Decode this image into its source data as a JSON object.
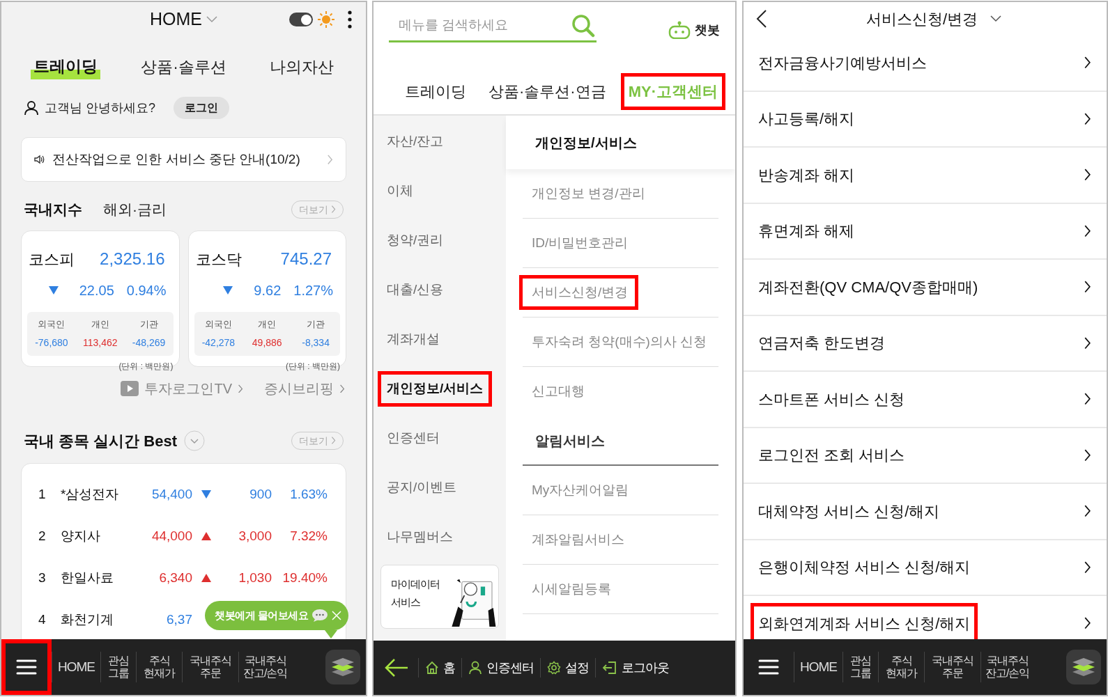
{
  "home_screen": {
    "header": {
      "title": "HOME",
      "dark_mode_toggle": {
        "on": true
      }
    },
    "tabs": [
      {
        "label": "트레이딩",
        "selected": true
      },
      {
        "label": "상품·솔루션",
        "selected": false
      },
      {
        "label": "나의자산",
        "selected": false
      }
    ],
    "greeting": "고객님 안녕하세요?",
    "login_button": "로그인",
    "notice": "전산작업으로 인한 서비스 중단 안내(10/2)",
    "index_tabs": [
      {
        "label": "국내지수",
        "selected": true
      },
      {
        "label": "해외·금리",
        "selected": false
      }
    ],
    "more_button": "더보기",
    "index_cards": [
      {
        "name": "코스피",
        "value": "2,325.16",
        "rising": false,
        "change": "22.05",
        "rate": "0.94%",
        "investors": [
          {
            "label": "외국인",
            "value": "-76,680",
            "rising": false
          },
          {
            "label": "개인",
            "value": "113,462",
            "rising": true
          },
          {
            "label": "기관",
            "value": "-48,269",
            "rising": false
          }
        ],
        "unit": "(단위 : 백만원)"
      },
      {
        "name": "코스닥",
        "value": "745.27",
        "rising": false,
        "change": "9.62",
        "rate": "1.27%",
        "investors": [
          {
            "label": "외국인",
            "value": "-42,278",
            "rising": false
          },
          {
            "label": "개인",
            "value": "49,886",
            "rising": true
          },
          {
            "label": "기관",
            "value": "-8,334",
            "rising": false
          }
        ],
        "unit": "(단위 : 백만원)"
      }
    ],
    "links": [
      {
        "label": "투자로그인TV",
        "kind": "video"
      },
      {
        "label": "증시브리핑",
        "kind": "plain"
      }
    ],
    "best": {
      "title": "국내 종목 실시간 Best",
      "more_button": "더보기",
      "rows": [
        {
          "rank": "1",
          "name": "*삼성전자",
          "price": "54,400",
          "rising": false,
          "change": "900",
          "rate": "1.63%"
        },
        {
          "rank": "2",
          "name": "양지사",
          "price": "44,000",
          "rising": true,
          "change": "3,000",
          "rate": "7.32%"
        },
        {
          "rank": "3",
          "name": "한일사료",
          "price": "6,340",
          "rising": true,
          "change": "1,030",
          "rate": "19.40%"
        },
        {
          "rank": "4",
          "name": "화천기계",
          "price": "6,37",
          "rising": false
        }
      ]
    },
    "chatbot_bubble": "챗봇에게 물어보세요",
    "bottom_nav": {
      "menu_highlighted": true,
      "items": [
        "HOME",
        "관심\n그룹",
        "주식\n현재가",
        "국내주식\n주문",
        "국내주식\n잔고/손익"
      ]
    }
  },
  "menu_screen": {
    "search": {
      "placeholder": "메뉴를 검색하세요"
    },
    "chatbot_button": "챗봇",
    "tabs": [
      {
        "label": "트레이딩",
        "selected": false,
        "highlighted": false
      },
      {
        "label": "상품·솔루션·연금",
        "selected": false,
        "highlighted": false
      },
      {
        "label": "MY·고객센터",
        "selected": true,
        "highlighted": true
      }
    ],
    "categories": [
      {
        "label": "자산/잔고",
        "selected": false,
        "highlighted": false
      },
      {
        "label": "이체",
        "selected": false,
        "highlighted": false
      },
      {
        "label": "청약/권리",
        "selected": false,
        "highlighted": false
      },
      {
        "label": "대출/신용",
        "selected": false,
        "highlighted": false
      },
      {
        "label": "계좌개설",
        "selected": false,
        "highlighted": false
      },
      {
        "label": "개인정보/서비스",
        "selected": true,
        "highlighted": true
      },
      {
        "label": "인증센터",
        "selected": false,
        "highlighted": false
      },
      {
        "label": "공지/이벤트",
        "selected": false,
        "highlighted": false
      },
      {
        "label": "나무멤버스",
        "selected": false,
        "highlighted": false
      }
    ],
    "promo_card": "마이데이터\n서비스",
    "sections": [
      {
        "title": "개인정보/서비스",
        "items": [
          {
            "label": "개인정보 변경/관리",
            "highlighted": false
          },
          {
            "label": "ID/비밀번호관리",
            "highlighted": false
          },
          {
            "label": "서비스신청/변경",
            "highlighted": true
          },
          {
            "label": "투자숙려 청약(매수)의사 신청",
            "highlighted": false
          },
          {
            "label": "신고대행",
            "highlighted": false
          }
        ]
      },
      {
        "title": "알림서비스",
        "items": [
          {
            "label": "My자산케어알림",
            "highlighted": false
          },
          {
            "label": "계좌알림서비스",
            "highlighted": false
          },
          {
            "label": "시세알림등록",
            "highlighted": false
          }
        ]
      }
    ],
    "bottom_bar": [
      {
        "label": "홈",
        "kind": "home"
      },
      {
        "label": "인증센터",
        "kind": "person"
      },
      {
        "label": "설정",
        "kind": "settings"
      },
      {
        "label": "로그아웃",
        "kind": "logout"
      }
    ]
  },
  "service_screen": {
    "title": "서비스신청/변경",
    "items": [
      {
        "label": "전자금융사기예방서비스",
        "highlighted": false
      },
      {
        "label": "사고등록/해지",
        "highlighted": false
      },
      {
        "label": "반송계좌 해지",
        "highlighted": false
      },
      {
        "label": "휴면계좌 해제",
        "highlighted": false
      },
      {
        "label": "계좌전환(QV CMA/QV종합매매)",
        "highlighted": false
      },
      {
        "label": "연금저축 한도변경",
        "highlighted": false
      },
      {
        "label": "스마트폰 서비스 신청",
        "highlighted": false
      },
      {
        "label": "로그인전 조회 서비스",
        "highlighted": false
      },
      {
        "label": "대체약정 서비스 신청/해지",
        "highlighted": false
      },
      {
        "label": "은행이체약정 서비스 신청/해지",
        "highlighted": false
      },
      {
        "label": "외화연계계좌 서비스 신청/해지",
        "highlighted": true
      }
    ],
    "bottom_nav": {
      "menu_highlighted": false,
      "items": [
        "HOME",
        "관심\n그룹",
        "주식\n현재가",
        "국내주식\n주문",
        "국내주식\n잔고/손익"
      ]
    }
  }
}
